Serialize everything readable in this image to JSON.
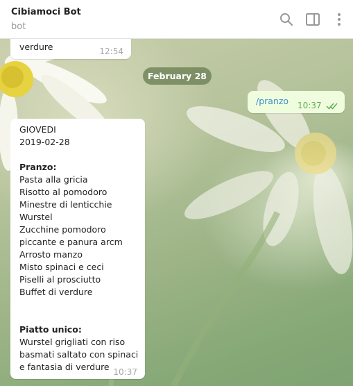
{
  "header": {
    "title": "Cibiamoci Bot",
    "subtitle": "bot",
    "icons": [
      "search-icon",
      "sidebar-toggle-icon",
      "more-vertical-icon"
    ]
  },
  "messages": {
    "previous": {
      "text": "verdure",
      "time": "12:54"
    },
    "date_separator": "February 28",
    "outgoing": {
      "text": "/pranzo",
      "time": "10:37",
      "status": "read"
    },
    "menu": {
      "time": "10:37",
      "lines": [
        {
          "text": "GIOVEDI",
          "bold": false
        },
        {
          "text": "2019-02-28",
          "bold": false
        },
        {
          "text": "Pranzo:",
          "bold": true
        },
        {
          "text": "Pasta alla gricia",
          "bold": false
        },
        {
          "text": "Risotto al pomodoro",
          "bold": false
        },
        {
          "text": "Minestre di lenticchie",
          "bold": false
        },
        {
          "text": "Wurstel",
          "bold": false
        },
        {
          "text": "Zucchine pomodoro",
          "bold": false
        },
        {
          "text": "piccante e panura arcm",
          "bold": false
        },
        {
          "text": "Arrosto manzo",
          "bold": false
        },
        {
          "text": "Misto spinaci e ceci",
          "bold": false
        },
        {
          "text": "Piselli al prosciutto",
          "bold": false
        },
        {
          "text": "Buffet di verdure",
          "bold": false
        },
        {
          "text": "Piatto unico:",
          "bold": true
        },
        {
          "text": "Wurstel grigliati con riso",
          "bold": false
        },
        {
          "text": "basmati saltato con spinaci",
          "bold": false
        },
        {
          "text": "e fantasia di verdure",
          "bold": false
        }
      ]
    }
  },
  "colors": {
    "outgoing_bubble": "#effdde",
    "link": "#3a8fc9",
    "read_ticks": "#62ac55",
    "date_pill": "#687c50"
  }
}
